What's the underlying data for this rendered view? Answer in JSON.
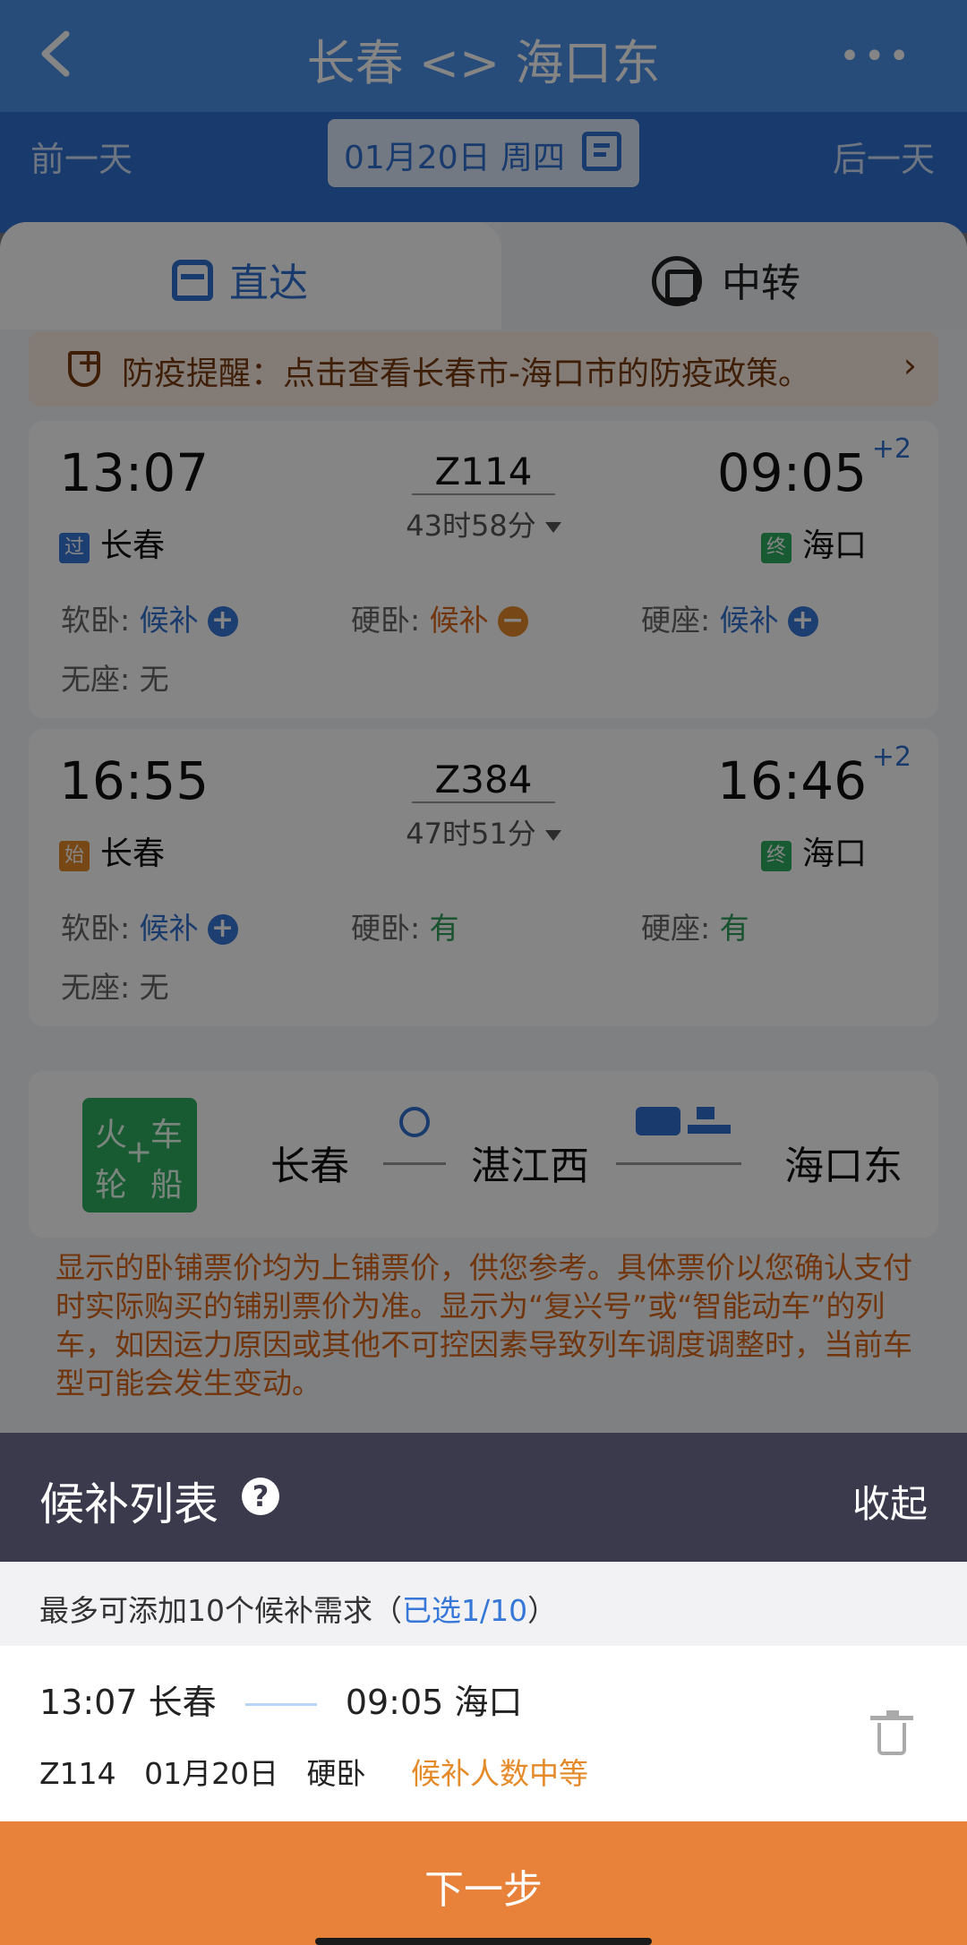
{
  "header": {
    "title": "长春 <> 海口东",
    "more_label": "•••"
  },
  "datebar": {
    "prev": "前一天",
    "date": "01月20日 周四",
    "next": "后一天"
  },
  "tabs": {
    "direct": "直达",
    "transfer": "中转"
  },
  "notice": {
    "text": "防疫提醒：点击查看长春市-海口市的防疫政策。",
    "chevron": "›"
  },
  "trains": [
    {
      "dep_time": "13:07",
      "arr_time": "09:05",
      "plus_day": "+2",
      "train_no": "Z114",
      "duration": "43时58分",
      "dep_tag": "过",
      "dep_station": "长春",
      "arr_tag": "终",
      "arr_station": "海口",
      "seats": [
        {
          "label": "软卧:",
          "value": "候补",
          "icon": "plus"
        },
        {
          "label": "硬卧:",
          "value": "候补",
          "icon": "minus"
        },
        {
          "label": "硬座:",
          "value": "候补",
          "icon": "plus"
        },
        {
          "label": "无座:",
          "value": "无"
        }
      ]
    },
    {
      "dep_time": "16:55",
      "arr_time": "16:46",
      "plus_day": "+2",
      "train_no": "Z384",
      "duration": "47时51分",
      "dep_tag": "始",
      "dep_station": "长春",
      "arr_tag": "终",
      "arr_station": "海口",
      "seats": [
        {
          "label": "软卧:",
          "value": "候补",
          "icon": "plus"
        },
        {
          "label": "硬卧:",
          "value": "有"
        },
        {
          "label": "硬座:",
          "value": "有"
        },
        {
          "label": "无座:",
          "value": "无"
        }
      ]
    }
  ],
  "route": {
    "logo": {
      "c1": "火",
      "c2": "车",
      "c3": "+",
      "c4": "轮",
      "c5": "船"
    },
    "stations": [
      "长春",
      "湛江西",
      "海口东"
    ]
  },
  "disclaimer": "显示的卧铺票价均为上铺票价，供您参考。具体票价以您确认支付时实际购买的铺别票价为准。显示为“复兴号”或“智能动车”的列车，如因运力原因或其他不可控因素导致列车调度调整时，当前车型可能会发生变动。",
  "sheet": {
    "title": "候补列表",
    "help": "?",
    "collapse": "收起",
    "limit_prefix": "最多可添加10个候补需求（",
    "limit_selected": "已选1/10",
    "limit_suffix": "）",
    "item": {
      "dep_time": "13:07",
      "dep_station": "长春",
      "arr_time": "09:05",
      "arr_station": "海口",
      "train_no": "Z114",
      "date": "01月20日",
      "seat": "硬卧",
      "level": "候补人数中等"
    },
    "next": "下一步"
  },
  "colors": {
    "primary": "#4d92ea",
    "accent_orange": "#e8823b",
    "sheet_header": "#3b3a4d",
    "green": "#2eae62"
  },
  "icons": [
    "back-icon",
    "more-icon",
    "calendar-icon",
    "train-icon",
    "transfer-icon",
    "shield-icon",
    "chevron-right-icon",
    "plus-circle-icon",
    "minus-circle-icon",
    "rail-icon",
    "bus-icon",
    "ship-icon",
    "help-icon",
    "trash-icon"
  ]
}
